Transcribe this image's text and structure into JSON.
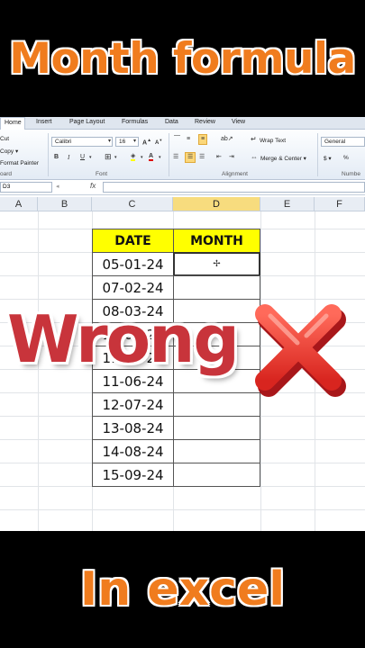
{
  "banner": {
    "top": "Month formula",
    "bottom": "In excel"
  },
  "overlay": {
    "text": "Wrong",
    "icon": "red-x-icon",
    "color": "#c8343b"
  },
  "ribbon": {
    "tabs": [
      "Home",
      "Insert",
      "Page Layout",
      "Formulas",
      "Data",
      "Review",
      "View"
    ],
    "active_tab": "Home",
    "clipboard": {
      "cut": "Cut",
      "copy": "Copy ▾",
      "format_painter": "Format Painter",
      "group": "oard"
    },
    "font": {
      "name": "Calibri",
      "size": "16",
      "group": "Font"
    },
    "alignment": {
      "wrap_text": "Wrap Text",
      "merge_center": "Merge & Center ▾",
      "group": "Alignment"
    },
    "number": {
      "format": "General",
      "currency": "$ ▾",
      "percent": "%",
      "group": "Numbe"
    }
  },
  "formula_bar": {
    "name_box": "D3",
    "fx": "fx",
    "value": ""
  },
  "columns": [
    "A",
    "B",
    "C",
    "D",
    "E",
    "F"
  ],
  "selected_column": "D",
  "table": {
    "headers": [
      "DATE",
      "MONTH"
    ],
    "dates": [
      "05-01-24",
      "07-02-24",
      "08-03-24",
      "10-04-24",
      "11-05-24",
      "11-06-24",
      "12-07-24",
      "13-08-24",
      "14-08-24",
      "15-09-24"
    ],
    "months": [
      "",
      "",
      "",
      "",
      "",
      "",
      "",
      "",
      "",
      ""
    ]
  },
  "colors": {
    "accent_orange": "#f07c1e",
    "header_yellow": "#ffff00",
    "selected_header": "#f7dc7e"
  }
}
